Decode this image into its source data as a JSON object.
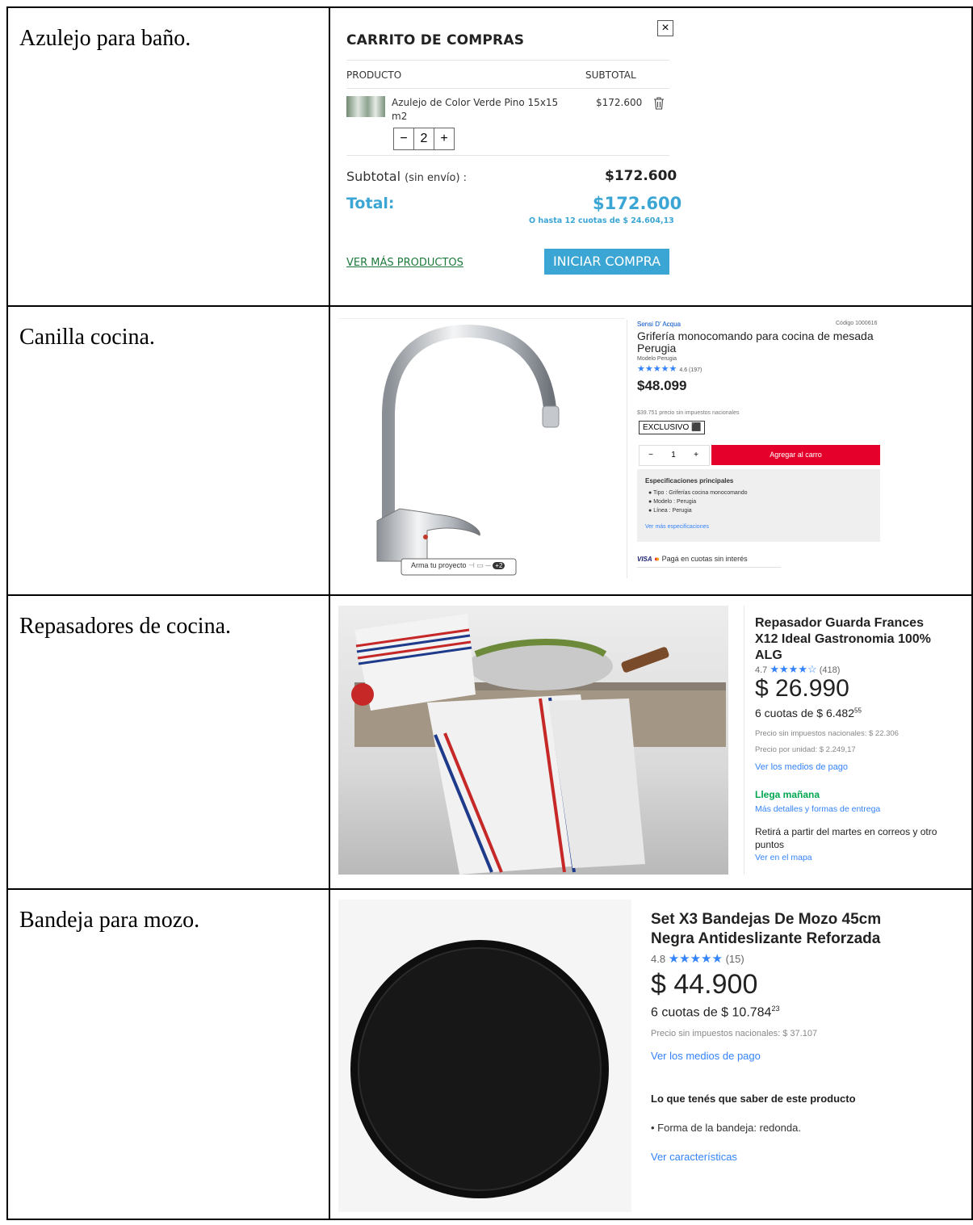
{
  "rows": [
    {
      "label": "Azulejo para baño."
    },
    {
      "label": "Canilla cocina."
    },
    {
      "label": "Repasadores de cocina."
    },
    {
      "label": "Bandeja para mozo."
    }
  ],
  "cart": {
    "title": "CARRITO DE COMPRAS",
    "close": "×",
    "col_product": "PRODUCTO",
    "col_subtotal": "SUBTOTAL",
    "item_name_1": "Azulejo de Color Verde Pino 15x15",
    "item_name_2": "m2",
    "item_price": "$172.600",
    "qty_minus": "−",
    "qty_value": "2",
    "qty_plus": "+",
    "subtotal_label": "Subtotal",
    "subtotal_note": "(sin envío) :",
    "subtotal_value": "$172.600",
    "total_label": "Total:",
    "total_value": "$172.600",
    "installments": "O hasta 12 cuotas de $ 24.604,13",
    "more_link": "VER MÁS PRODUCTOS",
    "buy_button": "INICIAR COMPRA"
  },
  "faucet": {
    "brand": "Sensi D' Acqua",
    "code": "Código 1000616",
    "title_1": "Grifería monocomando para cocina de mesada",
    "title_2": "Perugia",
    "model": "Modelo Perugia",
    "rating": "4.6 (197)",
    "price": "$48.099",
    "price_no_tax": "$39.751 precio sin impuestos nacionales",
    "exclusive": "EXCLUSIVO",
    "qty_minus": "−",
    "qty_value": "1",
    "qty_plus": "+",
    "add_button": "Agregar al carro",
    "spec_title": "Especificaciones principales",
    "spec_1": "Tipo : Griferías cocina monocomando",
    "spec_2": "Modelo : Perugia",
    "spec_3": "Línea : Perugia",
    "spec_link": "Ver más especificaciones",
    "payment": "Pagá en cuotas sin interés",
    "visa": "VISA",
    "project_button": "Arma tu proyecto",
    "project_count": "+2"
  },
  "towel": {
    "title_1": "Repasador Guarda Frances",
    "title_2": "X12 Ideal Gastronomia 100%",
    "title_3": "ALG",
    "rating": "4.7",
    "reviews": "(418)",
    "price": "$ 26.990",
    "installments": "6 cuotas de $ 6.482",
    "installments_cents": "55",
    "no_tax": "Precio sin impuestos nacionales: $ 22.306",
    "unit_price": "Precio por unidad: $ 2.249,17",
    "payment_link": "Ver los medios de pago",
    "delivery": "Llega mañana",
    "delivery_link": "Más detalles y formas de entrega",
    "pickup_1": "Retirá a partir del martes en correos y otro",
    "pickup_2": "puntos",
    "map_link": "Ver en el mapa"
  },
  "tray": {
    "title_1": "Set X3 Bandejas De Mozo 45cm",
    "title_2": "Negra Antideslizante Reforzada",
    "rating": "4.8",
    "reviews": "(15)",
    "price": "$ 44.900",
    "installments": "6 cuotas de $ 10.784",
    "installments_cents": "23",
    "no_tax": "Precio sin impuestos nacionales: $ 37.107",
    "payment_link": "Ver los medios de pago",
    "know_title": "Lo que tenés que saber de este producto",
    "know_item": "• Forma de la bandeja: redonda.",
    "features_link": "Ver características"
  },
  "colors": {
    "cart_blue": "#3ba6d4",
    "ml_blue": "#3483fa",
    "sodimac_red": "#e4002b",
    "green": "#00a650"
  }
}
